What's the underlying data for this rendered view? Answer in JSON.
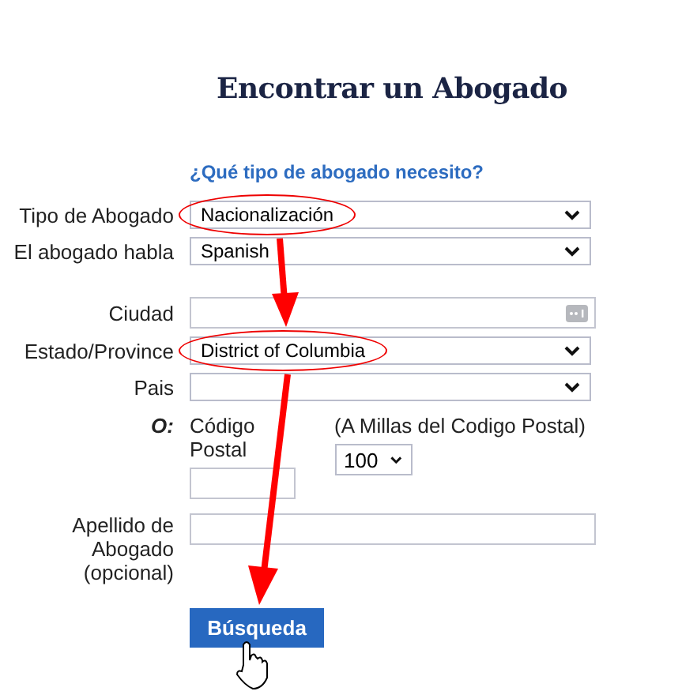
{
  "title": "Encontrar un Abogado",
  "subtitle": "¿Qué tipo de abogado necesito?",
  "sections": [
    [
      {
        "kind": "select",
        "label": "Tipo de Abogado",
        "value": "Nacionalización",
        "circled": true
      },
      {
        "kind": "select",
        "label": "El abogado habla",
        "value": "Spanish",
        "circled": false
      }
    ],
    [
      {
        "kind": "text",
        "label": "Ciudad",
        "autofill": true
      },
      {
        "kind": "select",
        "label": "Estado/Province",
        "value": "District of Columbia",
        "circled": true
      },
      {
        "kind": "select",
        "label": "Pais",
        "circled": false
      }
    ]
  ],
  "zip": {
    "or_label": "O:",
    "label": "Código Postal",
    "radius_label": "(A Millas del Codigo Postal)",
    "radius_value": "100"
  },
  "last_name": {
    "label": "Apellido de Abogado (opcional)"
  },
  "button": "Búsqueda"
}
